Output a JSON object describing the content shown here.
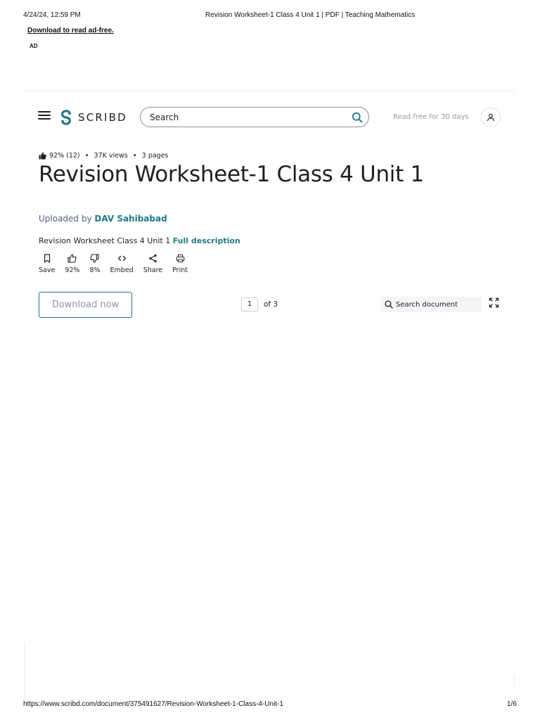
{
  "print_header": {
    "datetime": "4/24/24, 12:59 PM",
    "page_title": "Revision Worksheet-1 Class 4 Unit 1 | PDF | Teaching Mathematics"
  },
  "banner": {
    "download_adfree": "Download to read ad-free.",
    "ad_label": "AD"
  },
  "header": {
    "logo_text": "SCRIBD",
    "search_placeholder": "Search",
    "read_free": "Read free for 30 days",
    "brand_color": "#1e7b85"
  },
  "document": {
    "rating": "92% (12)",
    "views": "37K views",
    "pages": "3 pages",
    "title": "Revision Worksheet-1 Class 4 Unit 1",
    "uploaded_by_label": "Uploaded by",
    "uploader": "DAV Sahibabad",
    "description": "Revision Worksheet Class 4 Unit 1",
    "full_description_link": "Full description"
  },
  "actions": [
    {
      "label": "Save",
      "icon": "bookmark-icon"
    },
    {
      "label": "92%",
      "icon": "thumbs-up-icon"
    },
    {
      "label": "8%",
      "icon": "thumbs-down-icon"
    },
    {
      "label": "Embed",
      "icon": "embed-code-icon"
    },
    {
      "label": "Share",
      "icon": "share-icon"
    },
    {
      "label": "Print",
      "icon": "print-icon"
    }
  ],
  "viewer": {
    "download_now": "Download now",
    "current_page": "1",
    "of_pages": "of 3",
    "search_document": "Search document"
  },
  "print_footer": {
    "url": "https://www.scribd.com/document/375491627/Revision-Worksheet-1-Class-4-Unit-1",
    "page": "1/6"
  }
}
